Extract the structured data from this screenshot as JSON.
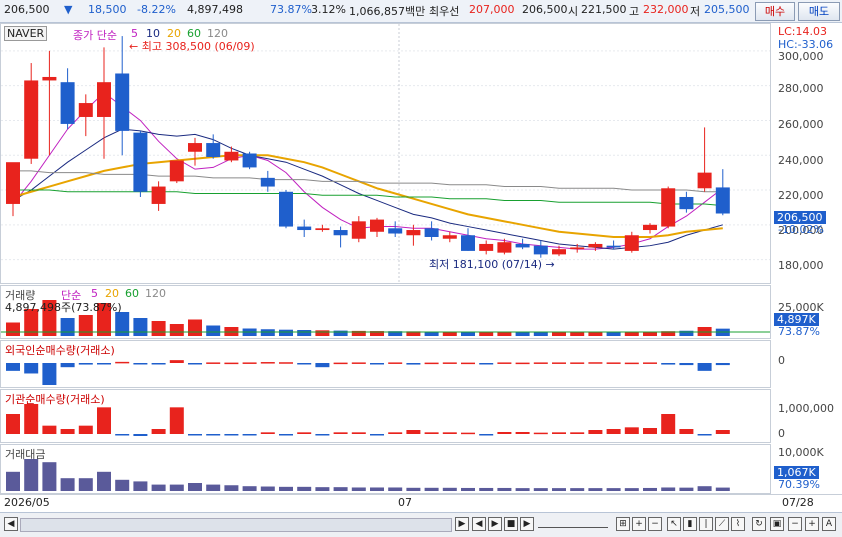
{
  "colors": {
    "up": "#e8231d",
    "down": "#1f5fcc",
    "ma5": "#c020c0",
    "ma10": "#1a2a80",
    "ma20": "#e8a400",
    "ma60": "#18a030",
    "ma120": "#8a8a8a",
    "vol_bar": "#5a5a9a"
  },
  "topbar": {
    "price": "206,500",
    "arrow": "▼",
    "change": "18,500",
    "change_pct": "-8.22%",
    "volume": "4,897,498",
    "vol_ratio": "73.87%",
    "turnover": "3.12%",
    "amount": "1,066,857백만",
    "best_label": "최우선",
    "ask": "207,000",
    "bid": "206,500",
    "open_label": "시",
    "open": "221,500",
    "high_label": "고",
    "high": "232,000",
    "low_label": "저",
    "low": "205,500",
    "buy": "매수",
    "sell": "매도"
  },
  "price_panel": {
    "stock_name": "NAVER",
    "legend_prefix": "종가 단순",
    "ma_labels": [
      "5",
      "10",
      "20",
      "60",
      "120"
    ],
    "high_note": "최고 308,500 (06/09)",
    "low_note": "최저 181,100 (07/14)",
    "lc": "LC:14.03",
    "hc": "HC:-33.06",
    "y_ticks": [
      "300,000",
      "280,000",
      "260,000",
      "240,000",
      "220,000",
      "200,000",
      "180,000"
    ],
    "price_badge": "206,500",
    "pct_badge": "-10.02%"
  },
  "volume_panel": {
    "title": "거래량",
    "legend_prefix": "단순",
    "ma_labels": [
      "5",
      "20",
      "60",
      "120"
    ],
    "value_note": "4,897,498주(73.87%)",
    "y_tick": "25,000K",
    "badge": "4,897K",
    "pct": "73.87%"
  },
  "foreign_panel": {
    "title": "외국인순매수량(거래소)",
    "y_tick": "0"
  },
  "inst_panel": {
    "title": "기관순매수량(거래소)",
    "y_ticks": [
      "1,000,000",
      "0"
    ]
  },
  "amount_panel": {
    "title": "거래대금",
    "y_tick": "10,000K",
    "badge": "1,067K",
    "pct": "70.39%"
  },
  "x_axis": {
    "labels": [
      "2026/05",
      "07",
      "07/28"
    ]
  },
  "chart_data": {
    "type": "candlestick",
    "title": "NAVER",
    "ylim": [
      170000,
      312000
    ],
    "candles": [
      {
        "o": 212000,
        "h": 235000,
        "l": 205000,
        "c": 236000
      },
      {
        "o": 238000,
        "h": 293000,
        "l": 235000,
        "c": 283000
      },
      {
        "o": 283000,
        "h": 300000,
        "l": 240000,
        "c": 285000
      },
      {
        "o": 282000,
        "h": 290000,
        "l": 255000,
        "c": 258000
      },
      {
        "o": 262000,
        "h": 275000,
        "l": 251000,
        "c": 270000
      },
      {
        "o": 262000,
        "h": 302000,
        "l": 238000,
        "c": 282000
      },
      {
        "o": 287000,
        "h": 308500,
        "l": 240000,
        "c": 254000
      },
      {
        "o": 253000,
        "h": 254000,
        "l": 216000,
        "c": 219000
      },
      {
        "o": 212000,
        "h": 225000,
        "l": 208000,
        "c": 222000
      },
      {
        "o": 225000,
        "h": 237000,
        "l": 224000,
        "c": 237000
      },
      {
        "o": 242000,
        "h": 250000,
        "l": 234000,
        "c": 247000
      },
      {
        "o": 247000,
        "h": 252000,
        "l": 238000,
        "c": 239000
      },
      {
        "o": 237000,
        "h": 245000,
        "l": 236000,
        "c": 242000
      },
      {
        "o": 241000,
        "h": 242000,
        "l": 232000,
        "c": 233000
      },
      {
        "o": 227000,
        "h": 231000,
        "l": 219000,
        "c": 222000
      },
      {
        "o": 219000,
        "h": 220000,
        "l": 198000,
        "c": 199000
      },
      {
        "o": 199000,
        "h": 203000,
        "l": 193000,
        "c": 197000
      },
      {
        "o": 197000,
        "h": 200000,
        "l": 196000,
        "c": 198000
      },
      {
        "o": 197000,
        "h": 199000,
        "l": 187000,
        "c": 194000
      },
      {
        "o": 192000,
        "h": 205000,
        "l": 190000,
        "c": 202000
      },
      {
        "o": 196000,
        "h": 204000,
        "l": 193000,
        "c": 203000
      },
      {
        "o": 198000,
        "h": 202000,
        "l": 193000,
        "c": 195000
      },
      {
        "o": 194000,
        "h": 200000,
        "l": 188000,
        "c": 197000
      },
      {
        "o": 198000,
        "h": 202000,
        "l": 191000,
        "c": 193000
      },
      {
        "o": 192000,
        "h": 196000,
        "l": 190000,
        "c": 194000
      },
      {
        "o": 194000,
        "h": 198000,
        "l": 185000,
        "c": 185000
      },
      {
        "o": 185000,
        "h": 191000,
        "l": 183000,
        "c": 189000
      },
      {
        "o": 184000,
        "h": 192000,
        "l": 183000,
        "c": 190000
      },
      {
        "o": 189000,
        "h": 192000,
        "l": 186000,
        "c": 187000
      },
      {
        "o": 188000,
        "h": 191000,
        "l": 181100,
        "c": 183000
      },
      {
        "o": 183000,
        "h": 188000,
        "l": 182000,
        "c": 186000
      },
      {
        "o": 186000,
        "h": 189000,
        "l": 184000,
        "c": 187000
      },
      {
        "o": 187000,
        "h": 190000,
        "l": 185000,
        "c": 189000
      },
      {
        "o": 188000,
        "h": 191000,
        "l": 186000,
        "c": 187000
      },
      {
        "o": 185000,
        "h": 196000,
        "l": 184000,
        "c": 194000
      },
      {
        "o": 197000,
        "h": 201000,
        "l": 195000,
        "c": 200000
      },
      {
        "o": 199000,
        "h": 222000,
        "l": 198000,
        "c": 221000
      },
      {
        "o": 216000,
        "h": 219000,
        "l": 207000,
        "c": 209000
      },
      {
        "o": 221000,
        "h": 256000,
        "l": 219000,
        "c": 230000
      },
      {
        "o": 221500,
        "h": 232000,
        "l": 205500,
        "c": 206500
      }
    ],
    "ma_series": [
      {
        "name": "5",
        "values": [
          212000,
          225000,
          240000,
          255000,
          266000,
          276000,
          268000,
          260000,
          248000,
          238000,
          232000,
          233000,
          238000,
          240000,
          237000,
          230000,
          219000,
          210000,
          203000,
          198000,
          199000,
          199000,
          198000,
          198000,
          196000,
          194000,
          192000,
          191000,
          189000,
          188000,
          187000,
          186000,
          186000,
          187000,
          189000,
          192000,
          199000,
          205000,
          213000,
          221000
        ]
      },
      {
        "name": "10",
        "values": [
          214000,
          220000,
          228000,
          236000,
          243000,
          250000,
          255000,
          254000,
          252000,
          251000,
          252000,
          249000,
          244000,
          240000,
          238000,
          236000,
          232000,
          228000,
          223000,
          218000,
          214000,
          210000,
          206000,
          204000,
          201000,
          199000,
          197000,
          195000,
          193000,
          191000,
          189000,
          188000,
          187000,
          186000,
          187000,
          188000,
          190000,
          194000,
          197000,
          200000
        ]
      },
      {
        "name": "20",
        "values": [
          216000,
          219000,
          222000,
          225000,
          228000,
          231000,
          233000,
          235000,
          236000,
          237000,
          238000,
          239000,
          240000,
          240000,
          240000,
          238000,
          236000,
          233000,
          229000,
          225000,
          221000,
          218000,
          215000,
          212000,
          209000,
          206000,
          204000,
          202000,
          200000,
          198000,
          196000,
          195000,
          194000,
          193000,
          193000,
          193000,
          194000,
          196000,
          197000,
          198000
        ]
      },
      {
        "name": "60",
        "values": [
          220000,
          220000,
          220000,
          219000,
          219000,
          219000,
          219000,
          219000,
          219000,
          219000,
          218000,
          218000,
          218000,
          218000,
          218000,
          218000,
          218000,
          217000,
          217000,
          217000,
          217000,
          216000,
          216000,
          216000,
          215000,
          215000,
          215000,
          214000,
          214000,
          214000,
          213000,
          213000,
          213000,
          213000,
          213000,
          213000,
          212000,
          212000,
          212000,
          211000
        ]
      },
      {
        "name": "120",
        "values": [
          231000,
          231000,
          230000,
          230000,
          230000,
          229000,
          229000,
          229000,
          228000,
          228000,
          228000,
          227000,
          227000,
          227000,
          226000,
          226000,
          226000,
          225000,
          225000,
          225000,
          224000,
          224000,
          224000,
          224000,
          223000,
          223000,
          223000,
          222000,
          222000,
          222000,
          221000,
          221000,
          221000,
          221000,
          220000,
          220000,
          220000,
          220000,
          219000,
          219000
        ]
      }
    ],
    "volume": [
      9000,
      18000,
      24000,
      12000,
      14000,
      22000,
      16000,
      12000,
      10000,
      8000,
      11000,
      7000,
      6000,
      5000,
      4500,
      4200,
      4000,
      3800,
      3600,
      3400,
      3300,
      3200,
      3100,
      3000,
      2900,
      2800,
      2800,
      2700,
      2600,
      2600,
      2500,
      2500,
      2400,
      2400,
      2500,
      2700,
      3200,
      3500,
      6000,
      4897
    ],
    "foreign": [
      -150000,
      -200000,
      -420000,
      -80000,
      -30000,
      -20000,
      60000,
      -20000,
      -10000,
      150000,
      -20000,
      30000,
      20000,
      30000,
      50000,
      40000,
      -20000,
      -80000,
      20000,
      30000,
      -20000,
      30000,
      -30000,
      20000,
      30000,
      20000,
      -20000,
      30000,
      20000,
      30000,
      30000,
      30000,
      40000,
      30000,
      20000,
      30000,
      -30000,
      -40000,
      -150000,
      -40000
    ],
    "institution": [
      600000,
      900000,
      250000,
      150000,
      250000,
      800000,
      -200000,
      -300000,
      150000,
      800000,
      -50000,
      -50000,
      -100000,
      -60000,
      50000,
      -50000,
      50000,
      -40000,
      50000,
      50000,
      -50000,
      50000,
      120000,
      50000,
      50000,
      40000,
      -40000,
      60000,
      60000,
      40000,
      50000,
      50000,
      120000,
      150000,
      200000,
      180000,
      600000,
      150000,
      -180000,
      120000
    ],
    "trading_amount": [
      6000,
      10000,
      9000,
      4000,
      4000,
      6000,
      3500,
      3000,
      2000,
      2000,
      2500,
      2000,
      1800,
      1500,
      1400,
      1300,
      1300,
      1200,
      1200,
      1100,
      1100,
      1100,
      1000,
      1000,
      1000,
      950,
      950,
      950,
      900,
      900,
      900,
      900,
      900,
      900,
      900,
      950,
      1100,
      1050,
      1500,
      1067
    ]
  }
}
